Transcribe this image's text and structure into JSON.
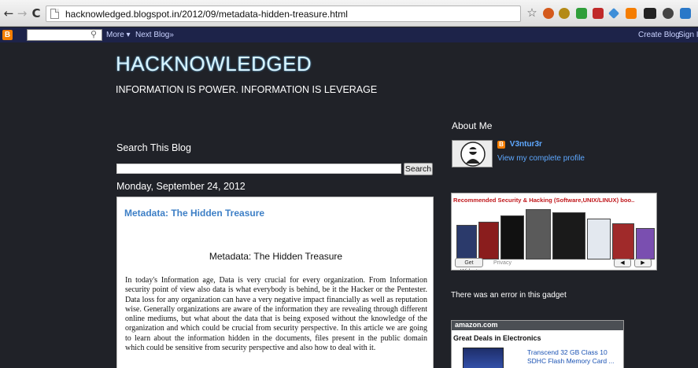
{
  "browser": {
    "url": "hacknowledged.blogspot.in/2012/09/metadata-hidden-treasure.html",
    "back_icon": "←",
    "forward_icon": "→",
    "reload_icon": "C",
    "star_icon": "☆"
  },
  "navbar": {
    "more_label": "More ▾",
    "next_blog_label": "Next Blog»",
    "create_blog_label": "Create Blog",
    "sign_in_label": "Sign I"
  },
  "blog": {
    "title": "HACKNOWLEDGED",
    "description": "INFORMATION IS POWER. INFORMATION IS LEVERAGE"
  },
  "search": {
    "title": "Search This Blog",
    "button_label": "Search"
  },
  "post": {
    "date": "Monday, September 24, 2012",
    "title": "Metadata: The Hidden Treasure",
    "heading": "Metadata: The Hidden Treasure",
    "body": "In today's Information age, Data is very crucial for every organization. From Information security point of view also data is what everybody is behind, be it the Hacker or the Pentester. Data loss for any organization can have a very negative impact financially as well as reputation wise. Generally organizations are aware of the information they are revealing through different online mediums, but what about the data that is being exposed without the knowledge of the organization and which could be crucial from security perspective. In this article we are going to learn about the information hidden in the documents, files present in the public domain which could be sensitive from security perspective and also how to deal with it."
  },
  "about": {
    "title": "About Me",
    "name": "V3ntur3r",
    "profile_link": "View my complete profile"
  },
  "books_widget": {
    "title": "Recommended Security & Hacking (Software,UNIX/LINUX) boo..",
    "get_widget_label": "Get Widget",
    "privacy_label": "Privacy",
    "prev_label": "◀",
    "next_label": "▶"
  },
  "gadget_error": "There was an error in this gadget",
  "amazon": {
    "logo": "amazon.com",
    "deals_title": "Great Deals in Electronics",
    "product_name": "Transcend 32 GB Class 10 SDHC Flash Memory Card ..."
  }
}
